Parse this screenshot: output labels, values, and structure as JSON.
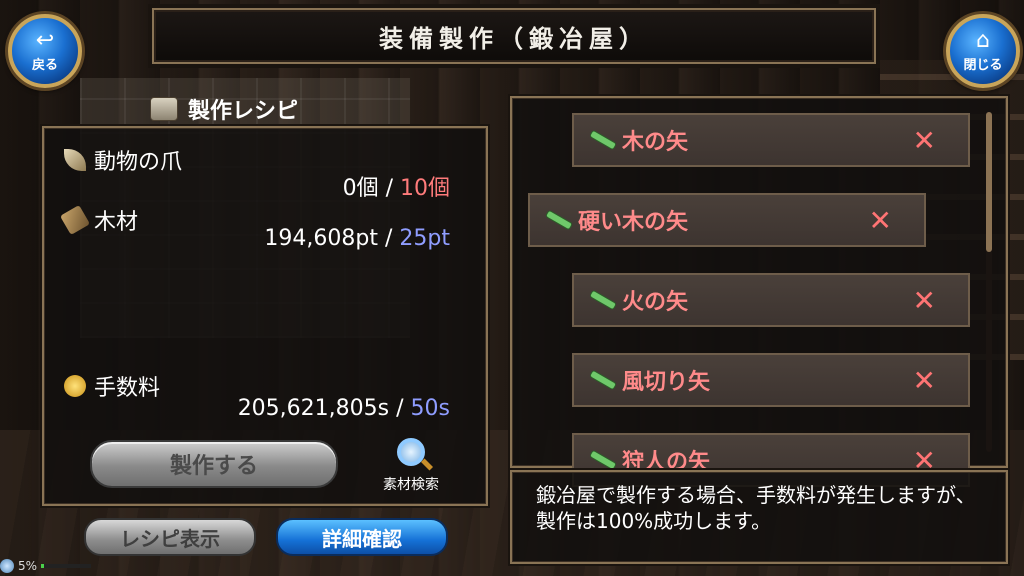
{
  "title": "装備製作（鍛冶屋）",
  "nav": {
    "back_label": "戻る",
    "close_label": "閉じる"
  },
  "recipe": {
    "header": "製作レシピ",
    "materials": [
      {
        "icon": "claw-icon",
        "name": "動物の爪",
        "have": "0個",
        "need": "10個"
      },
      {
        "icon": "wood-icon",
        "name": "木材",
        "have": "194,608pt",
        "need": "25pt"
      }
    ],
    "fee": {
      "icon": "coin-icon",
      "label": "手数料",
      "have": "205,621,805s",
      "need": "50s"
    },
    "separator": "/"
  },
  "actions": {
    "craft_label": "製作する",
    "search_label": "素材検索",
    "recipe_view_label": "レシピ表示",
    "details_label": "詳細確認"
  },
  "items": [
    {
      "name": "木の矢",
      "mark": "✕"
    },
    {
      "name": "硬い木の矢",
      "mark": "✕"
    },
    {
      "name": "火の矢",
      "mark": "✕"
    },
    {
      "name": "風切り矢",
      "mark": "✕"
    },
    {
      "name": "狩人の矢",
      "mark": "✕"
    }
  ],
  "message": "鍛冶屋で製作する場合、手数料が発生しますが、製作は100%成功します。",
  "status": {
    "battery_text": "5%",
    "battery_level": 0.05
  },
  "colors": {
    "need_short": "#ff7b7b",
    "need_ok": "#8f9dff",
    "item_text": "#ff8a8a",
    "accent_gold": "#8a7455"
  }
}
